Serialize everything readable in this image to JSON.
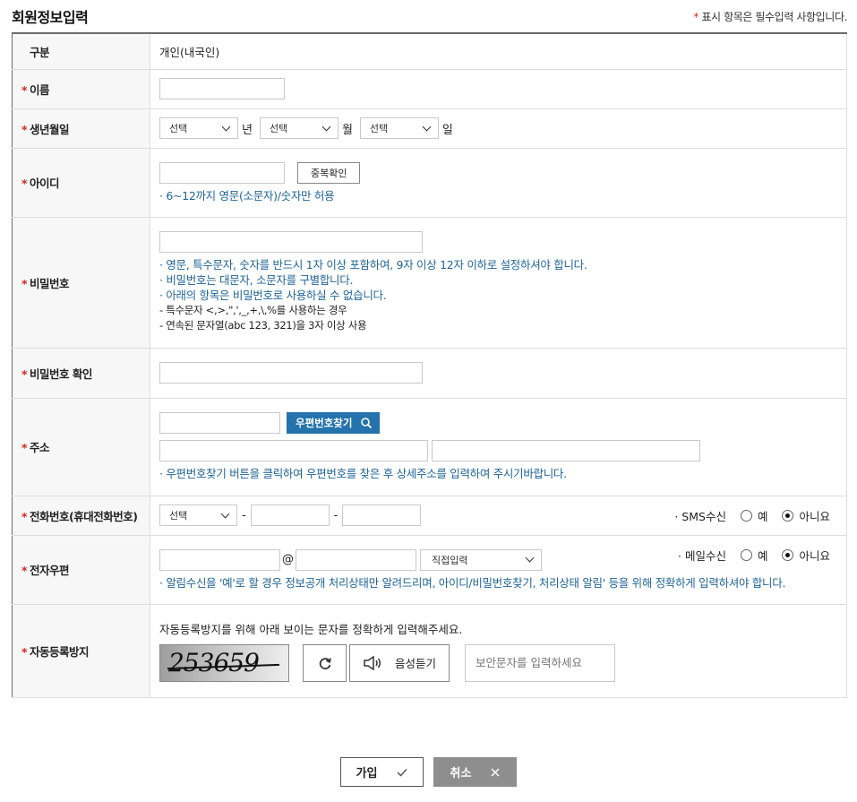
{
  "header": {
    "title": "회원정보입력",
    "required_mark": "*",
    "required_note": "표시 항목은 필수입력 사항입니다."
  },
  "rows": {
    "type": {
      "label": "구분",
      "value": "개인(내국인)"
    },
    "name": {
      "label": "이름",
      "value": ""
    },
    "birth": {
      "label": "생년월일",
      "year_select": "선택",
      "year_unit": "년",
      "month_select": "선택",
      "month_unit": "월",
      "day_select": "선택",
      "day_unit": "일"
    },
    "userid": {
      "label": "아이디",
      "value": "",
      "check_button": "중복확인",
      "help": "· 6~12까지 영문(소문자)/숫자만 허용"
    },
    "password": {
      "label": "비밀번호",
      "value": "",
      "help": [
        "· 영문, 특수문자, 숫자를 반드시 1자 이상 포함하여, 9자 이상 12자 이하로 설정하셔야 합니다.",
        "· 비밀번호는 대문자, 소문자를 구별합니다.",
        "· 아래의 항목은 비밀번호로 사용하실 수 없습니다."
      ],
      "restrictions": [
        "- 특수문자 <,>,\",',_,+,\\,%를 사용하는 경우",
        "- 연속된 문자열(abc 123, 321)을 3자 이상 사용"
      ]
    },
    "password_confirm": {
      "label": "비밀번호 확인",
      "value": ""
    },
    "address": {
      "label": "주소",
      "zip_value": "",
      "search_button": "우편번호찾기",
      "addr1": "",
      "addr2": "",
      "help": "· 우편번호찾기 버튼을 클릭하여 우편번호를 찾은 후 상세주소를 입력하여 주시기바랍니다."
    },
    "phone": {
      "label": "전화번호(휴대전화번호)",
      "prefix_select": "선택",
      "dash": "-",
      "mid": "",
      "last": "",
      "sms_label": "· SMS수신",
      "yes": "예",
      "no": "아니요",
      "sms_selected": "no"
    },
    "email": {
      "label": "전자우편",
      "local": "",
      "at": "@",
      "domain": "",
      "domain_select": "직접입력",
      "mail_label": "· 메일수신",
      "yes": "예",
      "no": "아니요",
      "mail_selected": "no",
      "help": "· 알림수신을 '예'로 할 경우 정보공개 처리상태만 알려드리며, 아이디/비밀번호찾기, 처리상태 알림' 등을 위해 정확하게 입력하셔야 합니다."
    },
    "captcha": {
      "label": "자동등록방지",
      "instruction": "자동등록방지를 위해 아래 보이는 문자를 정확하게 입력해주세요.",
      "image_text": "253659",
      "audio_button": "음성듣기",
      "placeholder": "보안문자를 입력하세요"
    }
  },
  "actions": {
    "join": "가입",
    "cancel": "취소"
  },
  "colors": {
    "accent_blue": "#2473ad",
    "help_blue": "#1f6496",
    "required_red": "#d3261e",
    "cancel_gray": "#8e8e8e"
  },
  "icons": {
    "search": "search-icon",
    "refresh": "refresh-icon",
    "speaker": "speaker-icon",
    "check": "check-icon",
    "close": "close-icon"
  }
}
